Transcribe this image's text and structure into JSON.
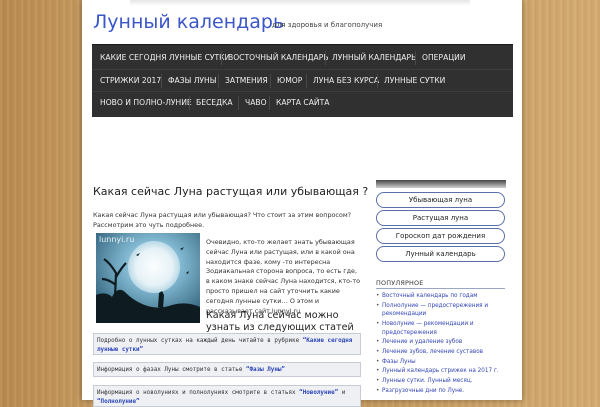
{
  "header": {
    "site_title": "Лунный календарь",
    "tagline": "для здоровья и благополучия"
  },
  "nav": {
    "rows": [
      [
        "КАКИЕ СЕГОДНЯ ЛУННЫЕ СУТКИ",
        "ВОСТОЧНЫЙ КАЛЕНДАРЬ",
        "ЛУННЫЙ КАЛЕНДАРЬ",
        "ОПЕРАЦИИ"
      ],
      [
        "СТРИЖКИ 2017",
        "ФАЗЫ ЛУНЫ",
        "ЗАТМЕНИЯ",
        "ЮМОР",
        "ЛУНА БЕЗ КУРСА",
        "ЛУННЫЕ СУТКИ"
      ],
      [
        "НОВО И ПОЛНО-ЛУНИЕ",
        "БЕСЕДКА",
        "ЧАВО",
        "КАРТА САЙТА"
      ]
    ]
  },
  "post": {
    "title": "Какая сейчас Луна растущая или убывающая ?",
    "intro": "Какая сейчас Луна растущая или убывающая? Что стоит за этим вопросом? Рассмотрим это чуть подробнее.",
    "image_watermark": "lunnyi.ru",
    "image_text": "Очевидно, кто-то желает знать убывающая сейчас Луна или растущая, или в какой она находится фазе, кому -то интересна Зодиакальная сторона вопроса, то есть где, в каком знаке сейчас Луна находится, кто-то просто пришел на сайт уточнить какие сегодня лунные сутки… О этом и рассказывает сайт lunnyj.ru",
    "subhead": "Какая Луна сейчас можно узнать из следующих статей",
    "info_boxes": [
      {
        "text": "Подробно о лунных сутках на каждый день читайте в рубрике ",
        "link": "“Какие сегодня лунные сутки”"
      },
      {
        "text": "Информация о фазах Луны смотрите в статье ",
        "link": "“Фазы Луны”"
      },
      {
        "text": "Информация о новолуниях и полнолуниях смотрите в статьях ",
        "link": "“Новолуние”",
        "text2": " и ",
        "link2": "“Полнолуние”"
      }
    ]
  },
  "sidebar": {
    "buttons": [
      "Убывающая луна",
      "Растущая луна",
      "Гороскоп дат рождения",
      "Лунный календарь"
    ],
    "popular_title": "ПОПУЛЯРНОЕ",
    "popular": [
      "Восточный календарь по годам",
      "Полнолуние — предостережения и рекомендации",
      "Новолуние — рекомендации и предостережения",
      "Лечение и удаление зубов",
      "Лечение зубов, лечение суставов",
      "Фазы Луны",
      "Лунный календарь стрижек на 2017 г.",
      "Лунные сутки. Лунный месяц.",
      "Разгрузочные дни по Луне."
    ]
  },
  "colors": {
    "title": "#3a56c9",
    "nav_bg": "#303030",
    "link": "#3446b6",
    "button_border": "#5b6fa8"
  }
}
